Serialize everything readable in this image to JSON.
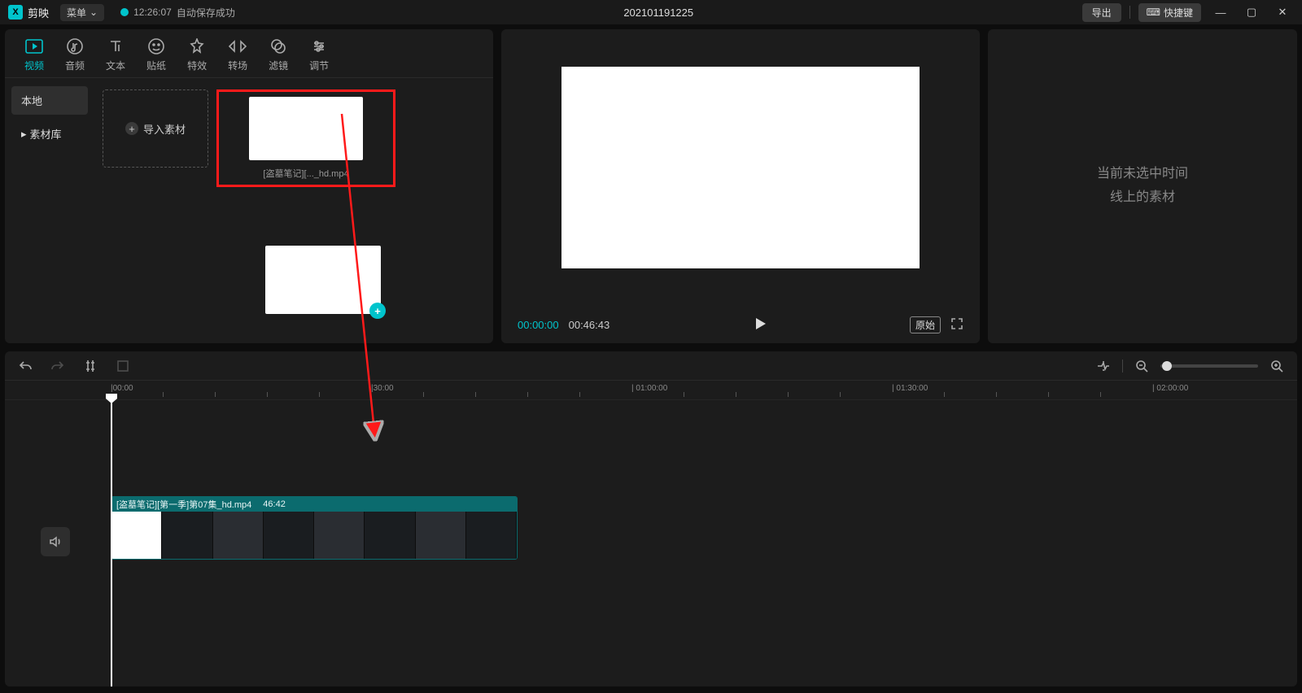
{
  "titlebar": {
    "app_name": "剪映",
    "menu_label": "菜单",
    "save_time": "12:26:07",
    "save_label": "自动保存成功",
    "project_title": "202101191225",
    "export_label": "导出",
    "shortcut_label": "快捷键"
  },
  "tool_tabs": [
    {
      "key": "video",
      "label": "视频",
      "active": true
    },
    {
      "key": "audio",
      "label": "音频"
    },
    {
      "key": "text",
      "label": "文本"
    },
    {
      "key": "sticker",
      "label": "贴纸"
    },
    {
      "key": "effect",
      "label": "特效"
    },
    {
      "key": "transition",
      "label": "转场"
    },
    {
      "key": "filter",
      "label": "滤镜"
    },
    {
      "key": "adjust",
      "label": "调节"
    }
  ],
  "sidebar": {
    "local": "本地",
    "library": "素材库"
  },
  "import_label": "导入素材",
  "media_clip": {
    "label": "[盗墓笔记][..._hd.mp4"
  },
  "preview": {
    "current": "00:00:00",
    "duration": "00:46:43",
    "ratio_label": "原始"
  },
  "inspector": {
    "empty_line1": "当前未选中时间",
    "empty_line2": "线上的素材"
  },
  "ruler": {
    "m0": "|00:00",
    "m1": "|30:00",
    "m2": "| 01:00:00",
    "m3": "| 01:30:00",
    "m4": "| 02:00:00"
  },
  "timeline_clip": {
    "filename": "[盗墓笔记][第一季]第07集_hd.mp4",
    "duration": "46:42"
  }
}
